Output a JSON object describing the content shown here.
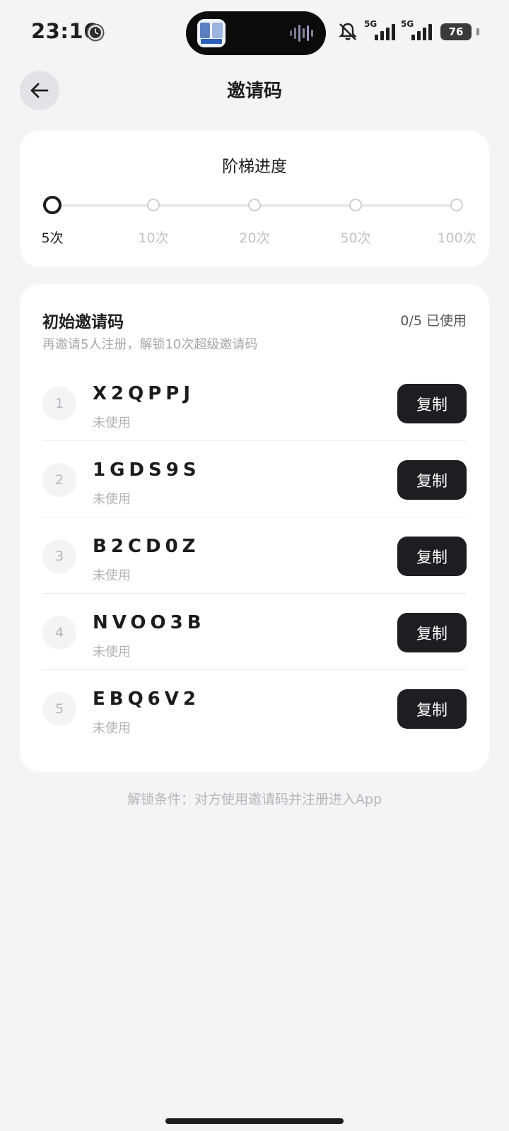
{
  "status_bar": {
    "time": "23:16",
    "network_label_1": "5G",
    "network_label_2": "5G",
    "battery": "76",
    "icons": [
      "clock-icon",
      "app-thumbnail-icon",
      "sound-wave-icon",
      "mute-icon",
      "signal-icon",
      "battery-icon"
    ]
  },
  "header": {
    "title": "邀请码",
    "back_icon": "arrow-left-icon"
  },
  "ladder": {
    "title": "阶梯进度",
    "steps": [
      {
        "label": "5次",
        "active": true
      },
      {
        "label": "10次",
        "active": false
      },
      {
        "label": "20次",
        "active": false
      },
      {
        "label": "50次",
        "active": false
      },
      {
        "label": "100次",
        "active": false
      }
    ]
  },
  "codes_section": {
    "title": "初始邀请码",
    "count": "0/5 已使用",
    "hint": "再邀请5人注册，解锁10次超级邀请码",
    "copy_label": "复制",
    "items": [
      {
        "index": "1",
        "code": "X2QPPJ",
        "status": "未使用"
      },
      {
        "index": "2",
        "code": "1GDS9S",
        "status": "未使用"
      },
      {
        "index": "3",
        "code": "B2CD0Z",
        "status": "未使用"
      },
      {
        "index": "4",
        "code": "NVOO3B",
        "status": "未使用"
      },
      {
        "index": "5",
        "code": "EBQ6V2",
        "status": "未使用"
      }
    ]
  },
  "footer_note": "解锁条件：对方使用邀请码并注册进入App",
  "colors": {
    "background": "#f4f4f5",
    "card": "#ffffff",
    "button": "#1e1e22",
    "muted_text": "#b3b3b8"
  }
}
